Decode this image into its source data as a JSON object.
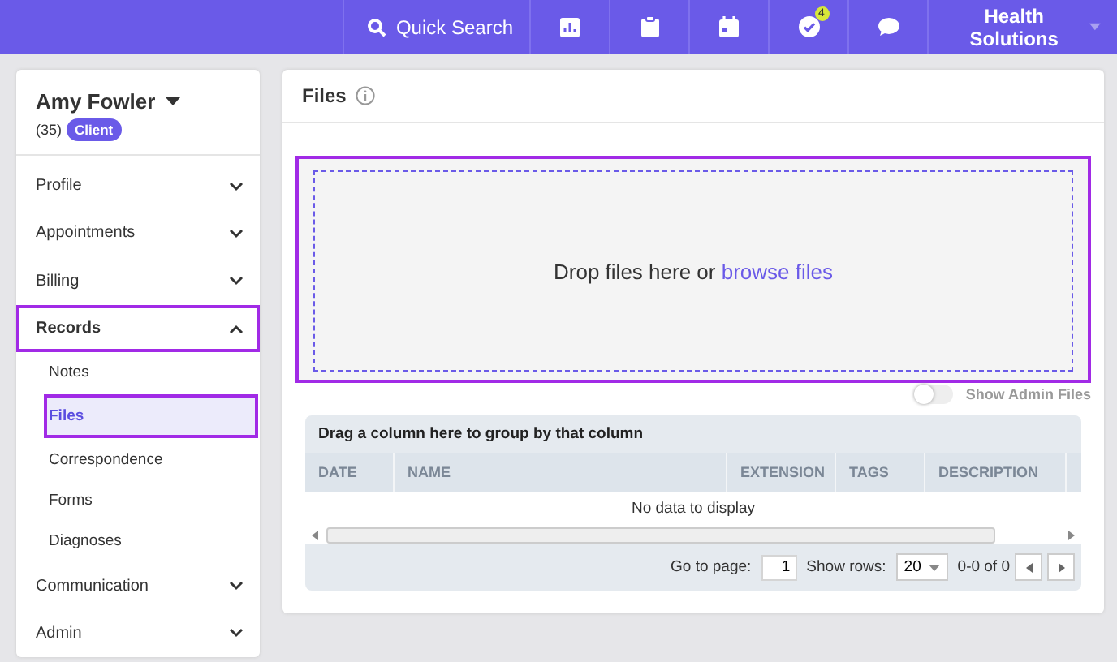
{
  "topbar": {
    "search_label": "Quick Search",
    "icons": [
      {
        "kind": "chart"
      },
      {
        "kind": "clipboard"
      },
      {
        "kind": "calendar"
      },
      {
        "kind": "tasks",
        "badge": "4"
      },
      {
        "kind": "chat"
      }
    ],
    "organization": "Health Solutions"
  },
  "client": {
    "name": "Amy Fowler",
    "count": "(35)",
    "tag": "Client"
  },
  "nav": [
    {
      "label": "Profile",
      "expanded": false,
      "highlighted": false
    },
    {
      "label": "Appointments",
      "expanded": false,
      "highlighted": false
    },
    {
      "label": "Billing",
      "expanded": false,
      "highlighted": false
    },
    {
      "label": "Records",
      "expanded": true,
      "highlighted": true,
      "children": [
        {
          "label": "Notes",
          "selected": false,
          "highlighted": false
        },
        {
          "label": "Files",
          "selected": true,
          "highlighted": true
        },
        {
          "label": "Correspondence",
          "selected": false,
          "highlighted": false
        },
        {
          "label": "Forms",
          "selected": false,
          "highlighted": false
        },
        {
          "label": "Diagnoses",
          "selected": false,
          "highlighted": false
        }
      ]
    },
    {
      "label": "Communication",
      "expanded": false,
      "highlighted": false
    },
    {
      "label": "Admin",
      "expanded": false,
      "highlighted": false
    }
  ],
  "page": {
    "title": "Files"
  },
  "dropzone": {
    "text": "Drop files here or",
    "link": "browse files",
    "highlighted": true
  },
  "admin_toggle": {
    "label": "Show Admin Files",
    "on": false
  },
  "grid": {
    "group_hint": "Drag a column here to group by that column",
    "columns": [
      "DATE",
      "NAME",
      "EXTENSION",
      "TAGS",
      "DESCRIPTION"
    ],
    "empty": "No data to display",
    "pager": {
      "go_label": "Go to page:",
      "page": "1",
      "rows_label": "Show rows:",
      "rows": "20",
      "range": "0-0 of 0"
    }
  }
}
